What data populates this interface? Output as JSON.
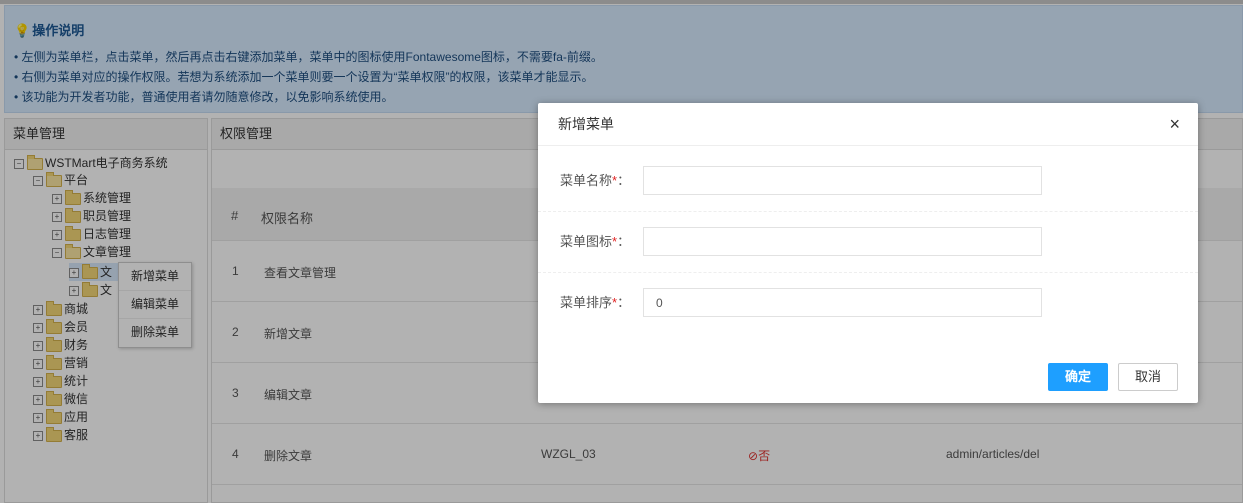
{
  "notice": {
    "title": "操作说明",
    "lines": [
      "• 左侧为菜单栏，点击菜单，然后再点击右键添加菜单，菜单中的图标使用Fontawesome图标，不需要fa-前缀。",
      "• 右侧为菜单对应的操作权限。若想为系统添加一个菜单则要一个设置为“菜单权限”的权限，该菜单才能显示。",
      "• 该功能为开发者功能，普通使用者请勿随意修改，以免影响系统使用。"
    ]
  },
  "left_panel": {
    "title": "菜单管理",
    "tree": {
      "root": "WSTMart电子商务系统",
      "platform": "平台",
      "platform_children": [
        "系统管理",
        "职员管理",
        "日志管理",
        "文章管理"
      ],
      "article_children": [
        "文",
        "文"
      ],
      "others": [
        "商城",
        "会员",
        "财务",
        "营销",
        "统计",
        "微信",
        "应用",
        "客服"
      ]
    },
    "context_menu": [
      "新增菜单",
      "编辑菜单",
      "删除菜单"
    ]
  },
  "right_panel": {
    "title": "权限管理",
    "columns": [
      "#",
      "权限名称"
    ],
    "rows": [
      {
        "no": "1",
        "name": "查看文章管理"
      },
      {
        "no": "2",
        "name": "新增文章"
      },
      {
        "no": "3",
        "name": "编辑文章"
      },
      {
        "no": "4",
        "name": "删除文章",
        "code": "WZGL_03",
        "menu_flag": "否",
        "url": "admin/articles/del"
      }
    ]
  },
  "modal": {
    "title": "新增菜单",
    "close_icon": "×",
    "fields": [
      {
        "label": "菜单名称",
        "required_mark": "*",
        "colon": "：",
        "value": ""
      },
      {
        "label": "菜单图标",
        "required_mark": "*",
        "colon": "：",
        "value": ""
      },
      {
        "label": "菜单排序",
        "required_mark": "*",
        "colon": "：",
        "value": "0"
      }
    ],
    "ok_label": "确定",
    "cancel_label": "取消"
  },
  "colors": {
    "notice_bg": "#d7ebff",
    "primary_button": "#1e9fff",
    "required": "#e02222"
  }
}
